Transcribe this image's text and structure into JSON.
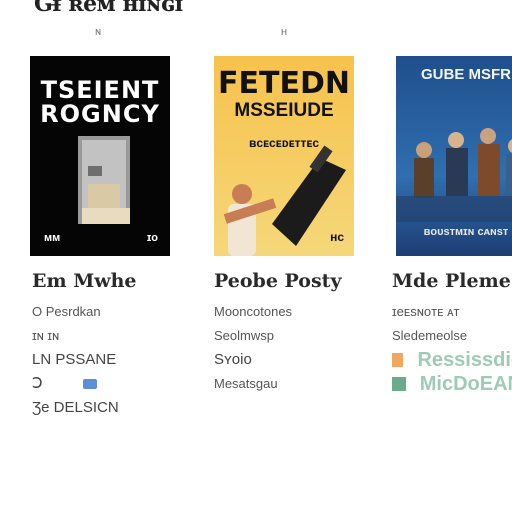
{
  "header": {
    "title": "Gf̶ ʀeᴍ ʜɪɴɢɪ",
    "sub_left": "ɴ",
    "sub_right": "ʜ"
  },
  "cards": [
    {
      "name": "black-cover",
      "title_line1": "TSEIENT",
      "title_line2": "ROGNCY",
      "bottom_left": "ᴍᴍ",
      "bottom_right": "ɪᴏ",
      "caption_title": "Em Mwhe",
      "lines": [
        "O  Pesrdkan",
        "ɪɴ ɪɴ",
        "LN PSSANE",
        "Ↄ",
        "Ʒe DELSICN"
      ]
    },
    {
      "name": "yellow-cover",
      "title_line1": "FETEDN",
      "title_line2": "MSSEIUDE",
      "title_line3": "ʙᴄᴇᴄᴇᴅᴇᴛᴛᴇᴄ",
      "bottom_right": "ʜᴄ",
      "caption_title": "Peobe Posty",
      "lines": [
        "Mooncotones",
        "Seolmwsp",
        "Sʏᴏiᴏ",
        "Mesatsgau"
      ]
    },
    {
      "name": "blue-cover",
      "title": "GUBE MSFR",
      "bottom_text": "ʙᴏᴜsᴛᴍɪɴ ᴄᴀɴsᴛ",
      "caption_title": "Mde Pleme",
      "lines": [
        "ɪeᴇsɴᴏᴛᴇ ᴀᴛ",
        "Sledemeolse"
      ],
      "accent_lines": [
        "Ressissdic",
        "MicDoEAN"
      ]
    }
  ],
  "colors": {
    "orange_swatch": "#f0a860",
    "green_swatch": "#6aab8a",
    "tag_blue": "#5b8fd8"
  }
}
